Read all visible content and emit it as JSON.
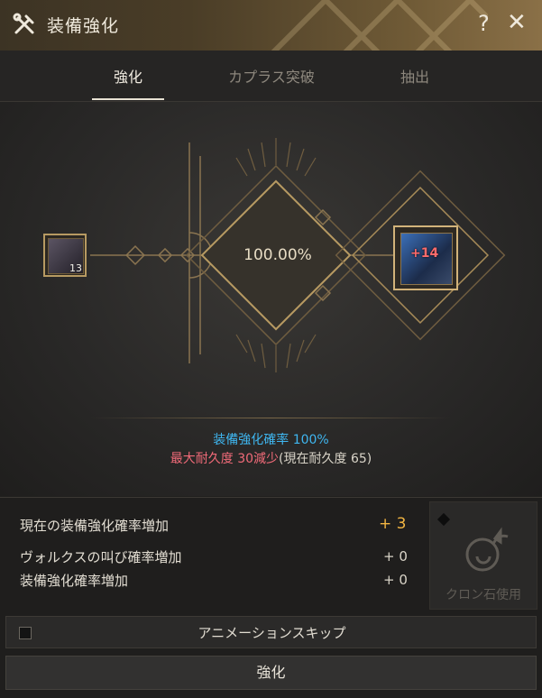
{
  "window": {
    "title": "装備強化"
  },
  "tabs": [
    {
      "label": "強化"
    },
    {
      "label": "カプラス突破"
    },
    {
      "label": "抽出"
    }
  ],
  "material": {
    "count": "13"
  },
  "enhance": {
    "rate": "100.00%",
    "result_level": "+14"
  },
  "info": {
    "rate_label": "装備強化確率",
    "rate_value": "100%",
    "durability_label": "最大耐久度",
    "durability_value": "30減少",
    "current_durability": "(現在耐久度 65)"
  },
  "bonuses": [
    {
      "label": "現在の装備強化確率増加",
      "value": "+ 3"
    },
    {
      "label": "ヴォルクスの叫び確率増加",
      "value": "+ 0"
    },
    {
      "label": "装備強化確率増加",
      "value": "+ 0"
    }
  ],
  "cron": {
    "label": "クロン石使用"
  },
  "skip": {
    "label": "アニメーションスキップ",
    "checked": false
  },
  "action": {
    "label": "強化"
  },
  "colors": {
    "accent_blue": "#3fb6f0",
    "durability_red": "#f06a78",
    "gold": "#f2b542",
    "frame_gold": "#b79a62"
  },
  "icons": {
    "title": "hammer-wrench-icon",
    "help": "question-icon",
    "close": "close-icon",
    "cron": "cron-stone-icon"
  }
}
